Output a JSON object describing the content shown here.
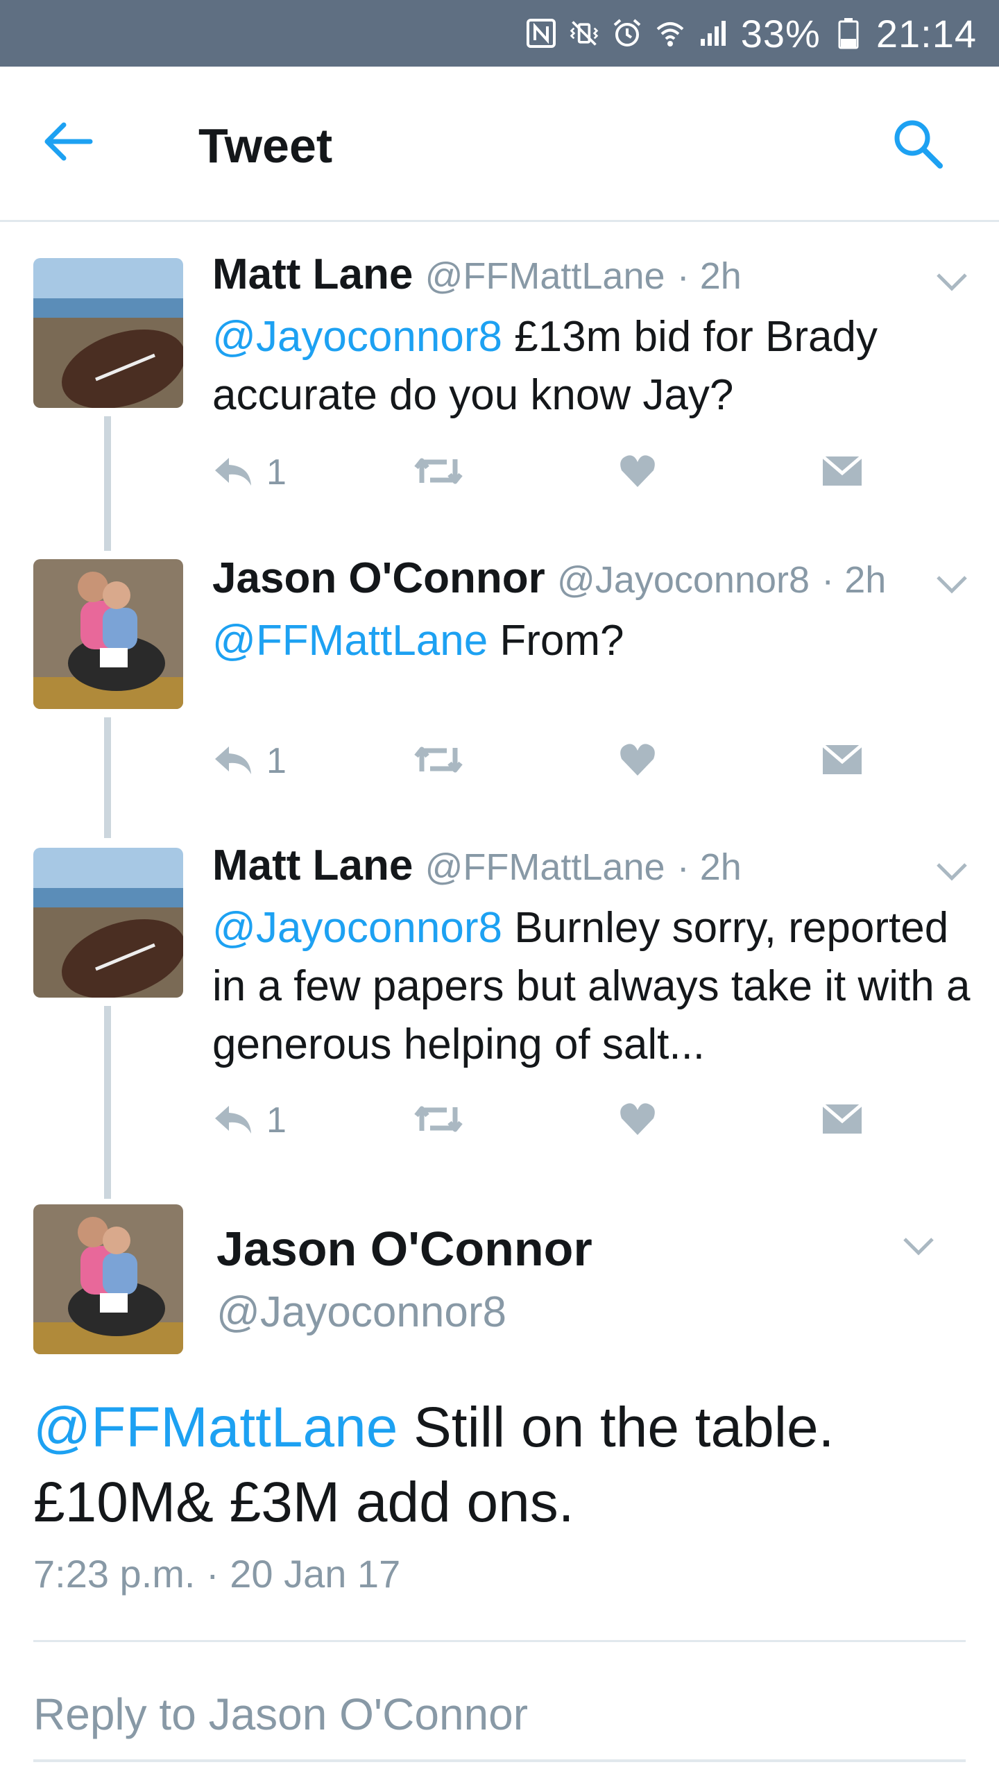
{
  "status_bar": {
    "battery": "33%",
    "time": "21:14",
    "icons": [
      "nfc-icon",
      "vibrate-icon",
      "alarm-icon",
      "wifi-icon",
      "signal-icon",
      "battery-icon"
    ]
  },
  "app_bar": {
    "title": "Tweet",
    "back_icon": "arrow-left-icon",
    "search_icon": "search-icon"
  },
  "tweets": [
    {
      "name": "Matt Lane",
      "handle": "@FFMattLane",
      "time": "· 2h",
      "mention": "@Jayoconnor8",
      "text": " £13m bid for Brady accurate do you know Jay?",
      "reply_count": "1"
    },
    {
      "name": "Jason O'Connor",
      "handle": "@Jayoconnor8",
      "time": "· 2h",
      "mention": "@FFMattLane",
      "text": " From?",
      "reply_count": "1"
    },
    {
      "name": "Matt Lane",
      "handle": "@FFMattLane",
      "time": "· 2h",
      "mention": "@Jayoconnor8",
      "text": " Burnley sorry, reported in a few papers but always take it with a generous helping of salt...",
      "reply_count": "1"
    }
  ],
  "main_tweet": {
    "name": "Jason O'Connor",
    "handle": "@Jayoconnor8",
    "mention": "@FFMattLane",
    "text_line1": " Still on the table.",
    "text_line2": "£10M& £3M add ons.",
    "timestamp": "7:23 p.m. · 20 Jan 17"
  },
  "reply": {
    "placeholder": "Reply to Jason O'Connor"
  },
  "colors": {
    "status_bar": "#5f6f82",
    "accent": "#1da1f2",
    "muted": "#8899a6",
    "action_icon": "#aab8c2",
    "divider": "#e1e8ed"
  }
}
